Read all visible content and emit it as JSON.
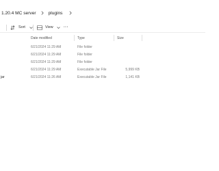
{
  "address": {
    "crumbs": [
      "1.20.4 MC server",
      "plugins"
    ]
  },
  "toolbar": {
    "sort_label": "Sort",
    "view_label": "View",
    "more_label": "···"
  },
  "columns": {
    "date_modified": "Date modified",
    "type": "Type",
    "size": "Size"
  },
  "rows": [
    {
      "name": "",
      "date": "6/21/2024 11:29 AM",
      "type": "File folder",
      "size": ""
    },
    {
      "name": "",
      "date": "6/21/2024 11:29 AM",
      "type": "File folder",
      "size": ""
    },
    {
      "name": "",
      "date": "6/21/2024 11:29 AM",
      "type": "File folder",
      "size": ""
    },
    {
      "name": "",
      "date": "6/21/2024 11:29 AM",
      "type": "Executable Jar File",
      "size": "5,999 KB"
    },
    {
      "name": "jar",
      "date": "6/21/2024 11:26 AM",
      "type": "Executable Jar File",
      "size": "1,141 KB"
    }
  ]
}
